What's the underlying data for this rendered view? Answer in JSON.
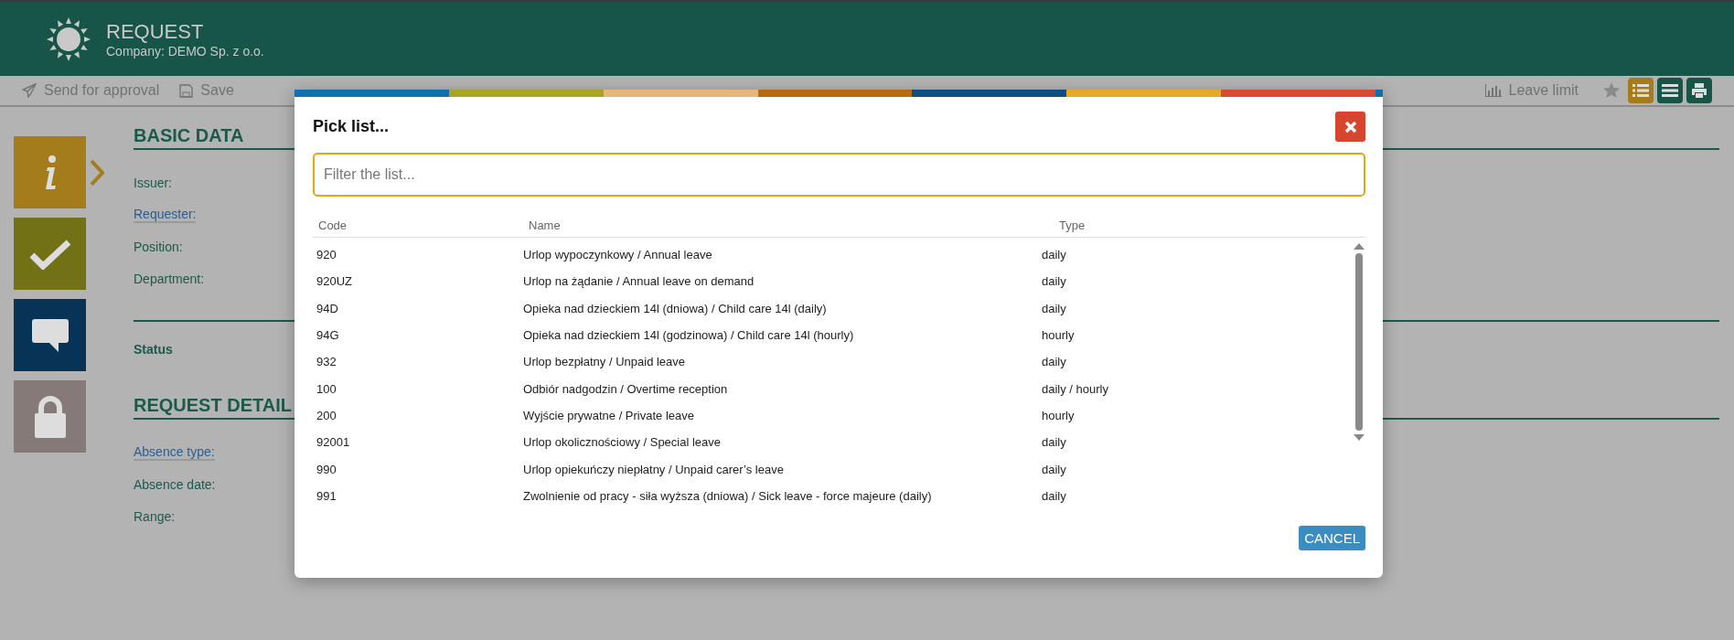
{
  "header": {
    "title": "REQUEST",
    "subtitle": "Company: DEMO Sp. z o.o."
  },
  "toolbar": {
    "actions": [
      {
        "kind": "send",
        "label": "Send for approval"
      },
      {
        "kind": "save",
        "label": "Save"
      }
    ],
    "leave_limit": "Leave limit",
    "icons": [
      {
        "kind": "star",
        "selected": false
      },
      {
        "kind": "list",
        "selected": true
      },
      {
        "kind": "menu",
        "selected": false
      },
      {
        "kind": "print",
        "selected": false
      }
    ]
  },
  "sidebar": {
    "tiles": [
      {
        "kind": "info",
        "color": "#a47c1b",
        "selected": true
      },
      {
        "kind": "check",
        "color": "#727116",
        "selected": false
      },
      {
        "kind": "comment",
        "color": "#063356",
        "selected": false
      },
      {
        "kind": "lock",
        "color": "#857a77",
        "selected": false
      }
    ]
  },
  "sections": [
    {
      "title": "BASIC DATA",
      "fields": [
        {
          "label": "Issuer:",
          "kind": "plain"
        },
        {
          "label": "Requester:",
          "kind": "link"
        },
        {
          "label": "Position:",
          "kind": "plain"
        },
        {
          "label": "Department:",
          "kind": "plain"
        }
      ],
      "status": "Status"
    },
    {
      "title": "REQUEST DETAIL",
      "fields": [
        {
          "label": "Absence type:",
          "kind": "link"
        },
        {
          "label": "Absence date:",
          "kind": "plain"
        },
        {
          "label": "Range:",
          "kind": "plain"
        }
      ]
    }
  ],
  "dialog": {
    "title": "Pick list...",
    "filter": {
      "placeholder": "Filter the list..."
    },
    "columns": [
      "Code",
      "Name",
      "Type"
    ],
    "rows": [
      [
        "920",
        "Urlop wypoczynkowy / Annual leave",
        "daily"
      ],
      [
        "920UZ",
        "Urlop na żądanie / Annual leave on demand",
        "daily"
      ],
      [
        "94D",
        "Opieka nad dzieckiem 14l (dniowa) / Child care 14l (daily)",
        "daily"
      ],
      [
        "94G",
        "Opieka nad dzieckiem 14l (godzinowa) / Child care 14l (hourly)",
        "hourly"
      ],
      [
        "932",
        "Urlop bezpłatny / Unpaid leave",
        "daily"
      ],
      [
        "100",
        "Odbiór nadgodzin / Overtime reception",
        "daily / hourly"
      ],
      [
        "200",
        "Wyjście prywatne / Private leave",
        "hourly"
      ],
      [
        "92001",
        "Urlop okolicznościowy / Special leave",
        "daily"
      ],
      [
        "990",
        "Urlop opiekuńczy niepłatny / Unpaid carer’s leave",
        "daily"
      ],
      [
        "991",
        "Zwolnienie od pracy - siła wyższa (dniowa) / Sick leave - force majeure (daily)",
        "daily"
      ]
    ],
    "cancel": "CANCEL"
  }
}
